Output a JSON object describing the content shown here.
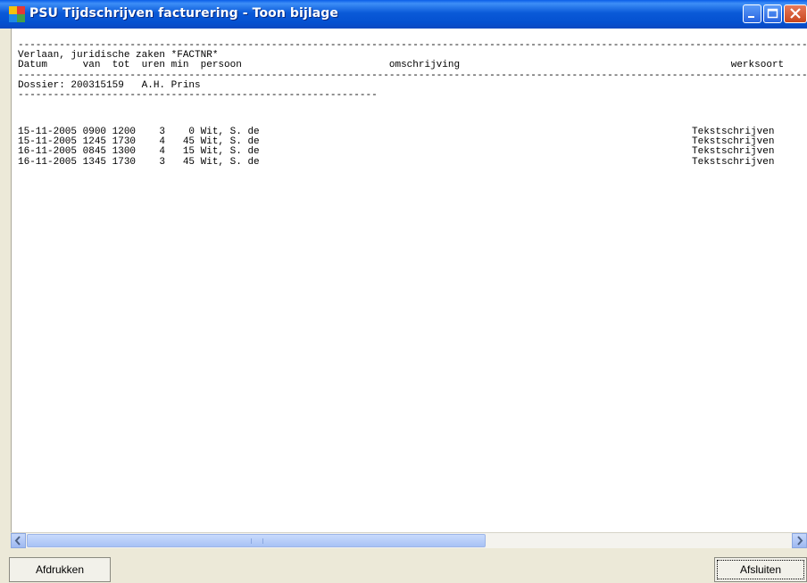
{
  "window": {
    "title": "PSU Tijdschrijven facturering - Toon bijlage"
  },
  "report": {
    "header_lines": "----------------------------------------------------------------------------------------------------------------------------------------------------\nVerlaan, juridische zaken *FACTNR*\nDatum      van  tot  uren min  persoon                         omschrijving                                              werksoort\n----------------------------------------------------------------------------------------------------------------------------------------------------\nDossier: 200315159   A.H. Prins\n-------------------------------------------------------------",
    "rows": [
      {
        "datum": "15-11-2005",
        "van": "0900",
        "tot": "1200",
        "uren": "3",
        "min": "0",
        "persoon": "Wit, S. de",
        "werksoort": "Tekstschrijven"
      },
      {
        "datum": "15-11-2005",
        "van": "1245",
        "tot": "1730",
        "uren": "4",
        "min": "45",
        "persoon": "Wit, S. de",
        "werksoort": "Tekstschrijven"
      },
      {
        "datum": "16-11-2005",
        "van": "0845",
        "tot": "1300",
        "uren": "4",
        "min": "15",
        "persoon": "Wit, S. de",
        "werksoort": "Tekstschrijven"
      },
      {
        "datum": "16-11-2005",
        "van": "1345",
        "tot": "1730",
        "uren": "3",
        "min": "45",
        "persoon": "Wit, S. de",
        "werksoort": "Tekstschrijven"
      }
    ]
  },
  "buttons": {
    "print": "Afdrukken",
    "close": "Afsluiten"
  },
  "icons": {
    "app": "psu-app-icon",
    "scroll_left": "chevron-left-icon",
    "scroll_right": "chevron-right-icon"
  },
  "colors": {
    "titlebar": "#0a5ad8",
    "close_button": "#c8461e",
    "window_bg": "#ece9d8"
  }
}
